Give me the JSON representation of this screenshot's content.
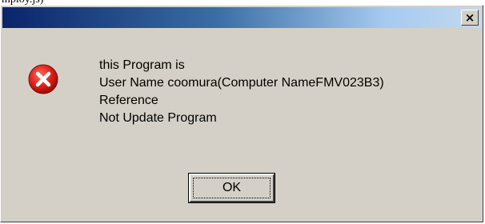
{
  "background_text": "mploy.js)",
  "dialog": {
    "title": "",
    "close_glyph": "×",
    "icon": "error-icon",
    "message_lines": [
      "this Program is",
      "User Name coomura(Computer NameFMV023B3)",
      "Reference",
      "Not Update Program"
    ],
    "ok_label": "OK"
  },
  "colors": {
    "dialog_bg": "#d4d0c8",
    "title_start": "#0a246a",
    "title_end": "#a6caf0",
    "error_red": "#e0201a"
  }
}
